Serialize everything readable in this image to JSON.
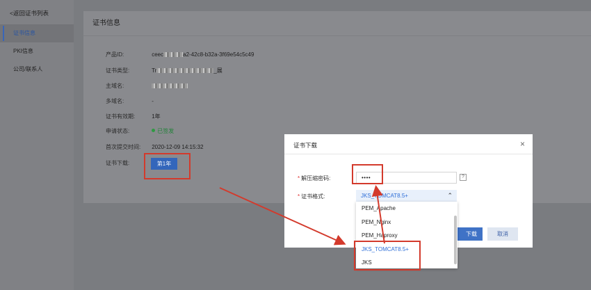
{
  "sidebar": {
    "back_label": "<返回证书列表",
    "items": [
      {
        "label": "证书信息",
        "active": true
      },
      {
        "label": "PKI信息",
        "active": false
      },
      {
        "label": "公司/联系人",
        "active": false
      }
    ]
  },
  "panel": {
    "title": "证书信息",
    "fields": {
      "product_id": {
        "label": "产品ID:",
        "prefix": "ceec",
        "suffix": "a2-42c8-b32a-3f69e54c5c49"
      },
      "cert_type": {
        "label": "证书类型:",
        "prefix": "Tr",
        "suffix": "_展"
      },
      "domain": {
        "label": "主域名:"
      },
      "multi_domain": {
        "label": "多域名:",
        "value": "-"
      },
      "validity": {
        "label": "证书有效期:",
        "value": "1年"
      },
      "status": {
        "label": "申请状态:",
        "value": "已签发"
      },
      "first_submit": {
        "label": "首次提交时间:",
        "value": "2020-12-09 14:15:32"
      },
      "download": {
        "label": "证书下载:",
        "button": "第1年"
      }
    }
  },
  "dialog": {
    "title": "证书下载",
    "close_glyph": "×",
    "password_label": "解压缩密码:",
    "password_value": "••••",
    "help_glyph": "?",
    "format_label": "证书格式:",
    "format_selected": "JKS_TOMCAT8.5+",
    "chevron_glyph": "⌃",
    "format_options": [
      "PEM_Apache",
      "PEM_Nginx",
      "PEM_Haproxy",
      "JKS_TOMCAT8.5+",
      "JKS"
    ],
    "ok_label": "下载",
    "cancel_label": "取消"
  },
  "colors": {
    "accent": "#3366bb",
    "selected_text": "#2f6fd8",
    "annotation": "#d33a2c",
    "status_green": "#2e9a43"
  }
}
